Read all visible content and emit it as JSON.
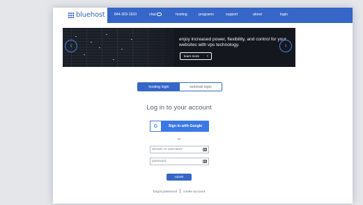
{
  "brand": {
    "name": "bluehost",
    "color": "#3566c8"
  },
  "nav": {
    "phone": "844-303-1810",
    "chat": "chat",
    "items": [
      "hosting",
      "programs",
      "support",
      "about",
      "login"
    ]
  },
  "banner": {
    "text": "enjoy increased power, flexibility, and control for your websites with vps technology.",
    "cta": "learn more",
    "prev_icon": "chevron-left-icon",
    "next_icon": "chevron-right-icon"
  },
  "tabs": [
    {
      "label": "hosting login",
      "active": true
    },
    {
      "label": "webmail login",
      "active": false
    }
  ],
  "login": {
    "title": "Log in to your account",
    "google_button": "Sign in with Google",
    "google_letter": "G",
    "or": "or",
    "id_placeholder": "domain or username",
    "password_placeholder": "password",
    "submit": "submit",
    "forgot": "forgot password",
    "create": "create account"
  }
}
